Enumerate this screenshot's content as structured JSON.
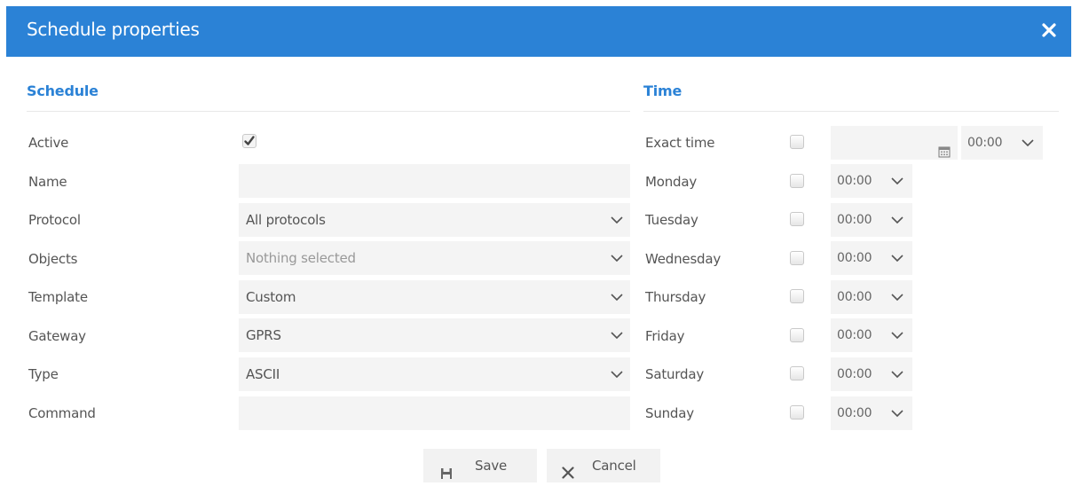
{
  "dialog": {
    "title": "Schedule properties",
    "close_icon": "close-icon"
  },
  "schedule": {
    "section_title": "Schedule",
    "fields": {
      "active": {
        "label": "Active",
        "checked": true
      },
      "name": {
        "label": "Name",
        "value": ""
      },
      "protocol": {
        "label": "Protocol",
        "value": "All protocols"
      },
      "objects": {
        "label": "Objects",
        "placeholder": "Nothing selected"
      },
      "template": {
        "label": "Template",
        "value": "Custom"
      },
      "gateway": {
        "label": "Gateway",
        "value": "GPRS"
      },
      "type": {
        "label": "Type",
        "value": "ASCII"
      },
      "command": {
        "label": "Command",
        "value": ""
      }
    }
  },
  "time": {
    "section_title": "Time",
    "exact_time": {
      "label": "Exact time",
      "date_value": "",
      "time_value": "00:00",
      "calendar_icon": "calendar-icon"
    },
    "days": [
      {
        "label": "Monday",
        "time": "00:00"
      },
      {
        "label": "Tuesday",
        "time": "00:00"
      },
      {
        "label": "Wednesday",
        "time": "00:00"
      },
      {
        "label": "Thursday",
        "time": "00:00"
      },
      {
        "label": "Friday",
        "time": "00:00"
      },
      {
        "label": "Saturday",
        "time": "00:00"
      },
      {
        "label": "Sunday",
        "time": "00:00"
      }
    ]
  },
  "buttons": {
    "save": {
      "label": "Save",
      "icon": "save-icon"
    },
    "cancel": {
      "label": "Cancel",
      "icon": "x-icon"
    }
  },
  "colors": {
    "accent": "#2b82d6",
    "field_bg": "#f4f4f4",
    "text": "#555555"
  }
}
